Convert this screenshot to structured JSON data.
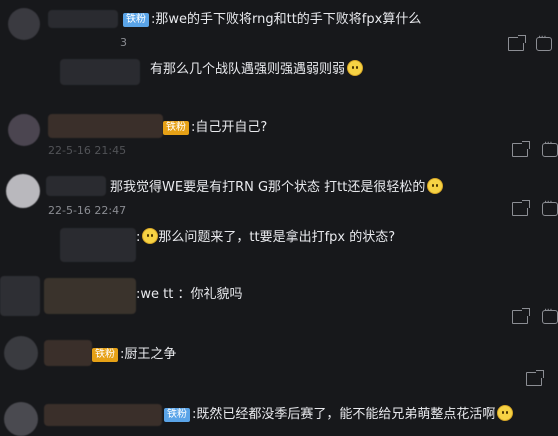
{
  "comments": [
    {
      "badge": "铁粉",
      "text": ":那we的手下败将rng和tt的手下败将fpx算什么",
      "time": "3"
    },
    {
      "badge": "",
      "text": "有那么几个战队遇强则强遇弱则弱",
      "time": ""
    },
    {
      "badge": "铁粉",
      "text": ":自己开自己?",
      "time": "22-5-16 21:45"
    },
    {
      "badge": "",
      "text": "那我觉得WE要是有打RN G那个状态 打tt还是很轻松的",
      "time": "22-5-16 22:47"
    },
    {
      "badge": "",
      "text": "那么问题来了，tt要是拿出打fpx 的状态?",
      "time": ""
    },
    {
      "badge": "",
      "text": ":we  tt ：你礼貌吗",
      "time": ""
    },
    {
      "badge": "铁粉",
      "text": ":厨王之争",
      "time": ""
    },
    {
      "badge": "铁粉",
      "text": ":既然已经都没季后赛了，能不能给兄弟萌整点花活啊",
      "time": ""
    }
  ],
  "icons": {
    "share": "share-icon",
    "comment": "comment-icon",
    "emoji": "emoji-icon"
  }
}
